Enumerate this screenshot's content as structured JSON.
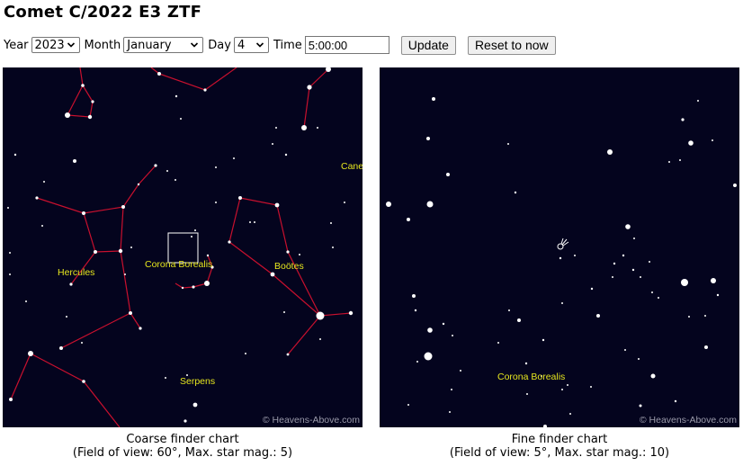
{
  "page_title": "Comet C/2022 E3 ZTF",
  "controls": {
    "year_label": "Year",
    "year_value": "2023",
    "month_label": "Month",
    "month_value": "January",
    "day_label": "Day",
    "day_value": "4",
    "time_label": "Time",
    "time_value": "5:00:00",
    "update_label": "Update",
    "reset_label": "Reset to now"
  },
  "colors": {
    "sky": "#04041e",
    "constellation_line": "#c8102e",
    "constellation_label": "#e6e61e",
    "star": "#ffffff",
    "credit": "#9a9aaa"
  },
  "coarse_chart": {
    "labels": [
      "Hercules",
      "Corona Borealis",
      "Boötes",
      "Serpens",
      "Canes"
    ],
    "credit": "© Heavens-Above.com",
    "caption_title": "Coarse finder chart",
    "caption_details": "(Field of view: 60°, Max. star mag.: 5)"
  },
  "fine_chart": {
    "labels": [
      "Corona Borealis"
    ],
    "comet_icon": "comet-icon",
    "credit": "© Heavens-Above.com",
    "caption_title": "Fine finder chart",
    "caption_details": "(Field of view: 5°, Max. star mag.: 10)"
  }
}
